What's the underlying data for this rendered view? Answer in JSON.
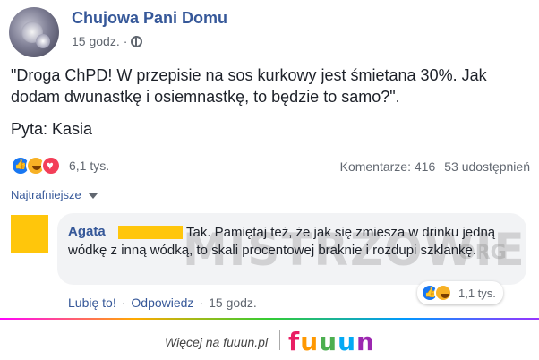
{
  "post": {
    "page_name": "Chujowa Pani Domu",
    "time": "15 godz.",
    "separator": "·",
    "body": "\"Droga ChPD! W przepisie na sos kurkowy jest śmietana 30%. Jak dodam dwunastkę i osiemnastkę, to będzie to samo?\".",
    "ask": "Pyta: Kasia",
    "reactions_count": "6,1 tys.",
    "comments_count": "Komentarze: 416",
    "shares_count": "53 udostępnień"
  },
  "sort": {
    "label": "Najtrafniejsze"
  },
  "comment": {
    "author": "Agata",
    "text": "Tak. Pamiętaj też, że jak się zmiesza w drinku jedną wódkę z inną wódką, to skali procentowej braknie i rozdupi szklankę.",
    "like_label": "Lubię to!",
    "reply_label": "Odpowiedz",
    "time": "15 godz.",
    "reactions_count": "1,1 tys.",
    "watermark": "MISTRZOWIE",
    "watermark_domain": "ORG"
  },
  "footer": {
    "text": "Więcej na fuuun.pl",
    "logo_letters": [
      "f",
      "u",
      "u",
      "u",
      "n"
    ]
  },
  "colors": {
    "link": "#365899",
    "redaction": "#ffc60b",
    "like": "#1877f2",
    "haha": "#f7b125",
    "love": "#f33e58"
  },
  "icons": [
    "globe-icon",
    "like-reaction-icon",
    "haha-reaction-icon",
    "love-reaction-icon",
    "chevron-down-icon"
  ]
}
